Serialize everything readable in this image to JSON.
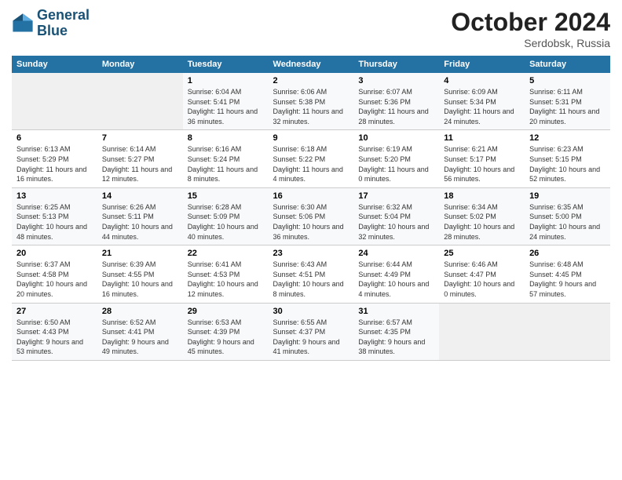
{
  "logo": {
    "line1": "General",
    "line2": "Blue"
  },
  "title": "October 2024",
  "subtitle": "Serdobsk, Russia",
  "days_of_week": [
    "Sunday",
    "Monday",
    "Tuesday",
    "Wednesday",
    "Thursday",
    "Friday",
    "Saturday"
  ],
  "weeks": [
    [
      {
        "day": "",
        "sunrise": "",
        "sunset": "",
        "daylight": ""
      },
      {
        "day": "",
        "sunrise": "",
        "sunset": "",
        "daylight": ""
      },
      {
        "day": "1",
        "sunrise": "Sunrise: 6:04 AM",
        "sunset": "Sunset: 5:41 PM",
        "daylight": "Daylight: 11 hours and 36 minutes."
      },
      {
        "day": "2",
        "sunrise": "Sunrise: 6:06 AM",
        "sunset": "Sunset: 5:38 PM",
        "daylight": "Daylight: 11 hours and 32 minutes."
      },
      {
        "day": "3",
        "sunrise": "Sunrise: 6:07 AM",
        "sunset": "Sunset: 5:36 PM",
        "daylight": "Daylight: 11 hours and 28 minutes."
      },
      {
        "day": "4",
        "sunrise": "Sunrise: 6:09 AM",
        "sunset": "Sunset: 5:34 PM",
        "daylight": "Daylight: 11 hours and 24 minutes."
      },
      {
        "day": "5",
        "sunrise": "Sunrise: 6:11 AM",
        "sunset": "Sunset: 5:31 PM",
        "daylight": "Daylight: 11 hours and 20 minutes."
      }
    ],
    [
      {
        "day": "6",
        "sunrise": "Sunrise: 6:13 AM",
        "sunset": "Sunset: 5:29 PM",
        "daylight": "Daylight: 11 hours and 16 minutes."
      },
      {
        "day": "7",
        "sunrise": "Sunrise: 6:14 AM",
        "sunset": "Sunset: 5:27 PM",
        "daylight": "Daylight: 11 hours and 12 minutes."
      },
      {
        "day": "8",
        "sunrise": "Sunrise: 6:16 AM",
        "sunset": "Sunset: 5:24 PM",
        "daylight": "Daylight: 11 hours and 8 minutes."
      },
      {
        "day": "9",
        "sunrise": "Sunrise: 6:18 AM",
        "sunset": "Sunset: 5:22 PM",
        "daylight": "Daylight: 11 hours and 4 minutes."
      },
      {
        "day": "10",
        "sunrise": "Sunrise: 6:19 AM",
        "sunset": "Sunset: 5:20 PM",
        "daylight": "Daylight: 11 hours and 0 minutes."
      },
      {
        "day": "11",
        "sunrise": "Sunrise: 6:21 AM",
        "sunset": "Sunset: 5:17 PM",
        "daylight": "Daylight: 10 hours and 56 minutes."
      },
      {
        "day": "12",
        "sunrise": "Sunrise: 6:23 AM",
        "sunset": "Sunset: 5:15 PM",
        "daylight": "Daylight: 10 hours and 52 minutes."
      }
    ],
    [
      {
        "day": "13",
        "sunrise": "Sunrise: 6:25 AM",
        "sunset": "Sunset: 5:13 PM",
        "daylight": "Daylight: 10 hours and 48 minutes."
      },
      {
        "day": "14",
        "sunrise": "Sunrise: 6:26 AM",
        "sunset": "Sunset: 5:11 PM",
        "daylight": "Daylight: 10 hours and 44 minutes."
      },
      {
        "day": "15",
        "sunrise": "Sunrise: 6:28 AM",
        "sunset": "Sunset: 5:09 PM",
        "daylight": "Daylight: 10 hours and 40 minutes."
      },
      {
        "day": "16",
        "sunrise": "Sunrise: 6:30 AM",
        "sunset": "Sunset: 5:06 PM",
        "daylight": "Daylight: 10 hours and 36 minutes."
      },
      {
        "day": "17",
        "sunrise": "Sunrise: 6:32 AM",
        "sunset": "Sunset: 5:04 PM",
        "daylight": "Daylight: 10 hours and 32 minutes."
      },
      {
        "day": "18",
        "sunrise": "Sunrise: 6:34 AM",
        "sunset": "Sunset: 5:02 PM",
        "daylight": "Daylight: 10 hours and 28 minutes."
      },
      {
        "day": "19",
        "sunrise": "Sunrise: 6:35 AM",
        "sunset": "Sunset: 5:00 PM",
        "daylight": "Daylight: 10 hours and 24 minutes."
      }
    ],
    [
      {
        "day": "20",
        "sunrise": "Sunrise: 6:37 AM",
        "sunset": "Sunset: 4:58 PM",
        "daylight": "Daylight: 10 hours and 20 minutes."
      },
      {
        "day": "21",
        "sunrise": "Sunrise: 6:39 AM",
        "sunset": "Sunset: 4:55 PM",
        "daylight": "Daylight: 10 hours and 16 minutes."
      },
      {
        "day": "22",
        "sunrise": "Sunrise: 6:41 AM",
        "sunset": "Sunset: 4:53 PM",
        "daylight": "Daylight: 10 hours and 12 minutes."
      },
      {
        "day": "23",
        "sunrise": "Sunrise: 6:43 AM",
        "sunset": "Sunset: 4:51 PM",
        "daylight": "Daylight: 10 hours and 8 minutes."
      },
      {
        "day": "24",
        "sunrise": "Sunrise: 6:44 AM",
        "sunset": "Sunset: 4:49 PM",
        "daylight": "Daylight: 10 hours and 4 minutes."
      },
      {
        "day": "25",
        "sunrise": "Sunrise: 6:46 AM",
        "sunset": "Sunset: 4:47 PM",
        "daylight": "Daylight: 10 hours and 0 minutes."
      },
      {
        "day": "26",
        "sunrise": "Sunrise: 6:48 AM",
        "sunset": "Sunset: 4:45 PM",
        "daylight": "Daylight: 9 hours and 57 minutes."
      }
    ],
    [
      {
        "day": "27",
        "sunrise": "Sunrise: 6:50 AM",
        "sunset": "Sunset: 4:43 PM",
        "daylight": "Daylight: 9 hours and 53 minutes."
      },
      {
        "day": "28",
        "sunrise": "Sunrise: 6:52 AM",
        "sunset": "Sunset: 4:41 PM",
        "daylight": "Daylight: 9 hours and 49 minutes."
      },
      {
        "day": "29",
        "sunrise": "Sunrise: 6:53 AM",
        "sunset": "Sunset: 4:39 PM",
        "daylight": "Daylight: 9 hours and 45 minutes."
      },
      {
        "day": "30",
        "sunrise": "Sunrise: 6:55 AM",
        "sunset": "Sunset: 4:37 PM",
        "daylight": "Daylight: 9 hours and 41 minutes."
      },
      {
        "day": "31",
        "sunrise": "Sunrise: 6:57 AM",
        "sunset": "Sunset: 4:35 PM",
        "daylight": "Daylight: 9 hours and 38 minutes."
      },
      {
        "day": "",
        "sunrise": "",
        "sunset": "",
        "daylight": ""
      },
      {
        "day": "",
        "sunrise": "",
        "sunset": "",
        "daylight": ""
      }
    ]
  ]
}
